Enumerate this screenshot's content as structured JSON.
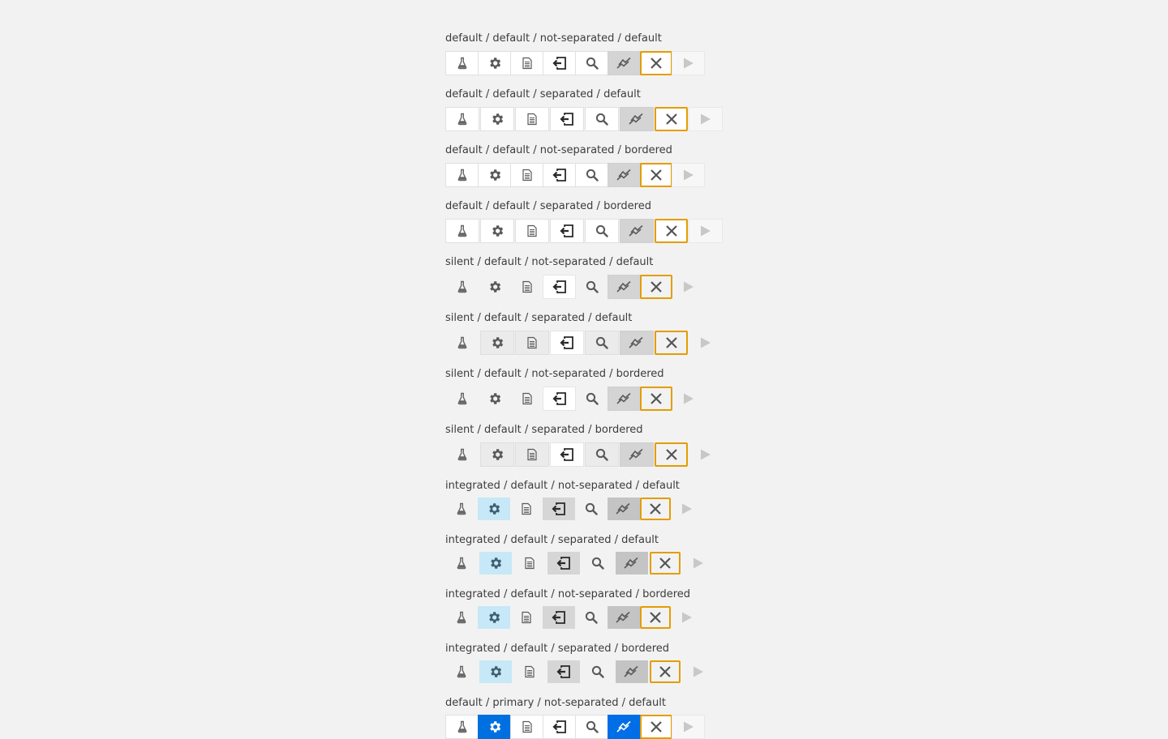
{
  "icons": [
    "flask-icon",
    "gear-icon",
    "document-icon",
    "exit-icon",
    "search-icon",
    "chart-line-icon",
    "close-icon",
    "play-icon"
  ],
  "colors": {
    "background": "#f2f2f2",
    "focus_border": "#e39d00",
    "hover_integrated": "#c7e8f6",
    "primary": "#0070e0",
    "selected": "#d4d4d4"
  },
  "groups": [
    {
      "label": "default / default / not-separated / default",
      "variant": "default",
      "separated": false
    },
    {
      "label": "default / default / separated / default",
      "variant": "default",
      "separated": true
    },
    {
      "label": "default / default / not-separated / bordered",
      "variant": "default",
      "separated": false
    },
    {
      "label": "default / default / separated / bordered",
      "variant": "default",
      "separated": true
    },
    {
      "label": "silent / default / not-separated / default",
      "variant": "silent",
      "separated": false
    },
    {
      "label": "silent / default / separated / default",
      "variant": "silent",
      "separated": true
    },
    {
      "label": "silent / default / not-separated / bordered",
      "variant": "silent",
      "separated": false
    },
    {
      "label": "silent / default / separated / bordered",
      "variant": "silent",
      "separated": true
    },
    {
      "label": "integrated / default / not-separated / default",
      "variant": "integrated",
      "separated": false
    },
    {
      "label": "integrated / default / separated / default",
      "variant": "integrated",
      "separated": true
    },
    {
      "label": "integrated / default / not-separated / bordered",
      "variant": "integrated",
      "separated": false
    },
    {
      "label": "integrated / default / separated / bordered",
      "variant": "integrated",
      "separated": true
    },
    {
      "label": "default / primary / not-separated / default",
      "variant": "primary",
      "separated": false
    }
  ]
}
